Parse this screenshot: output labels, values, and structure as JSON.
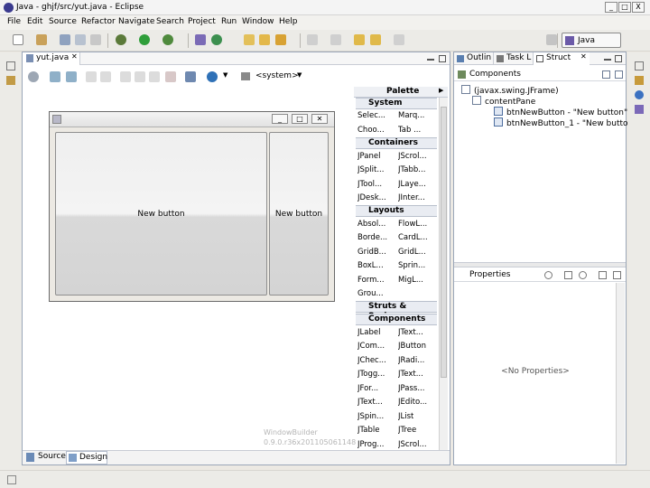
{
  "window": {
    "title": "Java - ghjf/src/yut.java - Eclipse",
    "min": "_",
    "max": "□",
    "close": "X"
  },
  "menu": [
    "File",
    "Edit",
    "Source",
    "Refactor",
    "Navigate",
    "Search",
    "Project",
    "Run",
    "Window",
    "Help"
  ],
  "perspective": {
    "label": "Java"
  },
  "editor": {
    "tab_label": "yut.java",
    "lnf_label": "<system>",
    "bottom_tabs": {
      "source": "Source",
      "design": "Design"
    },
    "frame": {
      "button1": "New button",
      "button2": "New button"
    },
    "watermark": {
      "line1": "WindowBuilder",
      "line2": "0.9.0.r36x201105061148"
    }
  },
  "palette": {
    "title": "Palette",
    "categories": [
      {
        "name": "System",
        "items": [
          "Selec...",
          "Marq...",
          "Choo...",
          "Tab ..."
        ]
      },
      {
        "name": "Containers",
        "items": [
          "JPanel",
          "JScrol...",
          "JSplit...",
          "JTabb...",
          "JTool...",
          "JLaye...",
          "JDesk...",
          "JInter..."
        ]
      },
      {
        "name": "Layouts",
        "items": [
          "Absol...",
          "FlowL...",
          "Borde...",
          "CardL...",
          "GridB...",
          "GridL...",
          "BoxL...",
          "Sprin...",
          "Form...",
          "MigL...",
          "Grou..."
        ]
      },
      {
        "name": "Struts & Springs",
        "items": []
      },
      {
        "name": "Components",
        "items": [
          "JLabel",
          "JText...",
          "JCom...",
          "JButton",
          "JChec...",
          "JRadi...",
          "JTogg...",
          "JText...",
          "JFor...",
          "JPass...",
          "JText...",
          "JEdito...",
          "JSpin...",
          "JList",
          "JTable",
          "JTree",
          "JProg...",
          "JScrol..."
        ]
      }
    ]
  },
  "right_tabs": {
    "outline": "Outlin",
    "tasklist": "Task L",
    "structure": "Struct"
  },
  "components": {
    "header": "Components",
    "tree": [
      "(javax.swing.JFrame)",
      "contentPane",
      "btnNewButton - \"New button\"",
      "btnNewButton_1 - \"New button\""
    ]
  },
  "properties": {
    "header": "Properties",
    "empty": "<No Properties>"
  },
  "colors": {
    "accent": "#2a5aa8",
    "panel_border": "#9aa6b8"
  }
}
